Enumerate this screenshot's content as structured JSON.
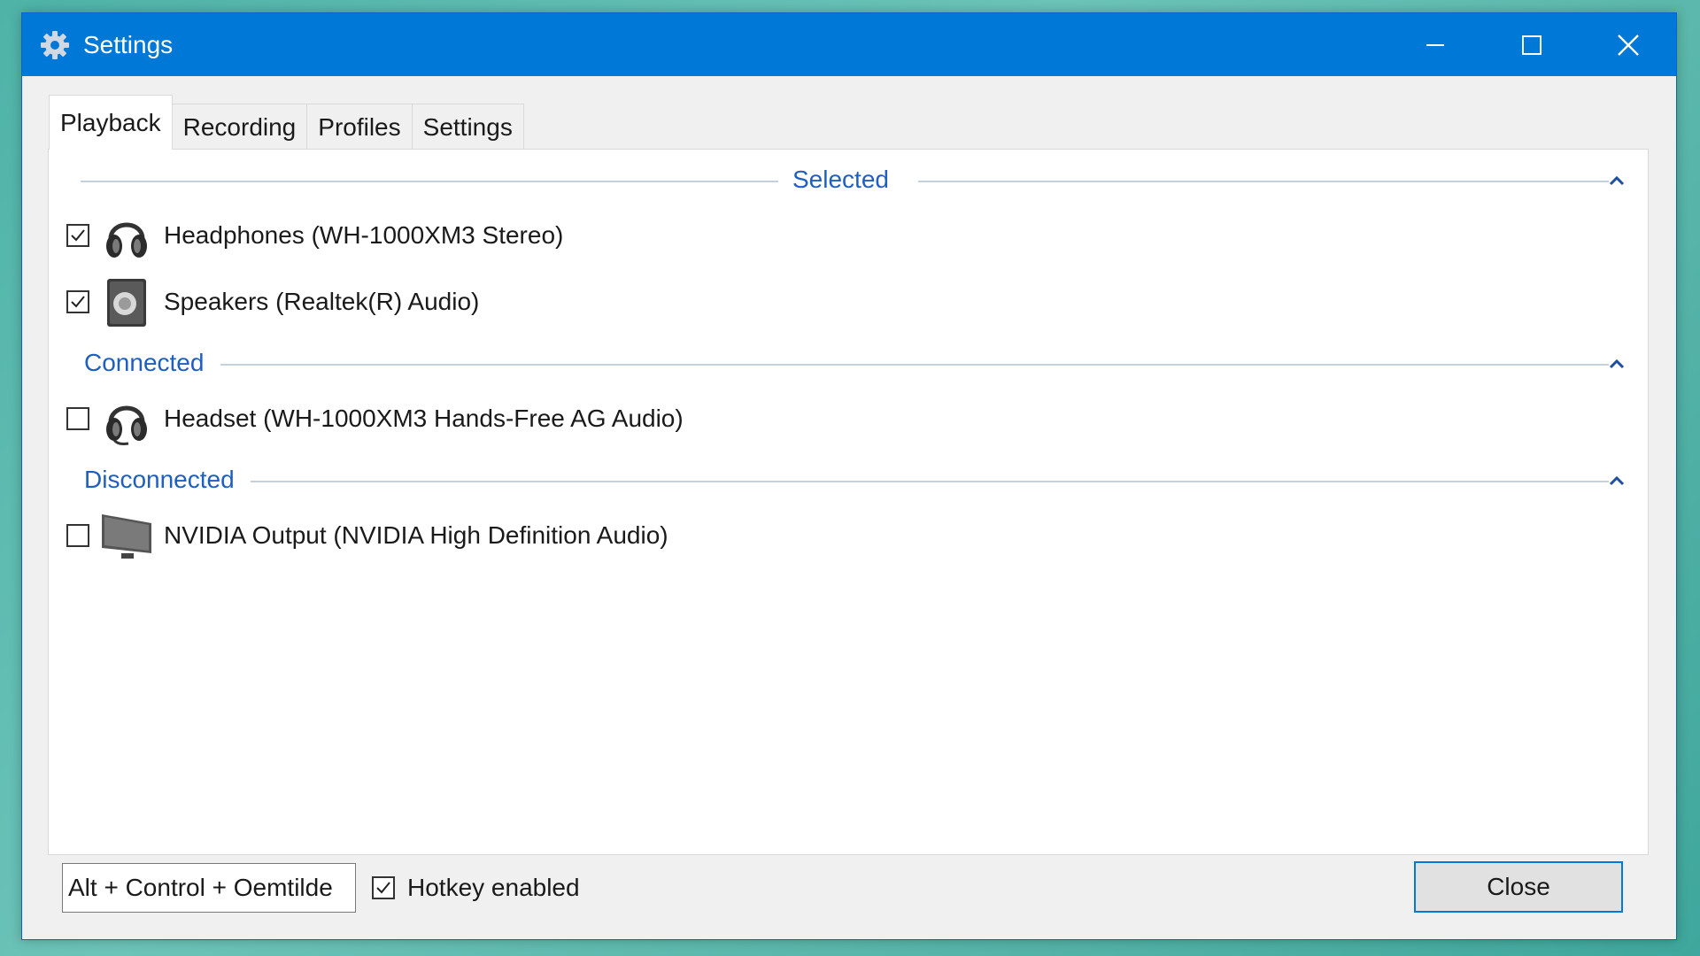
{
  "window": {
    "title": "Settings",
    "accent_color": "#0078d7",
    "icon": "gear-icon"
  },
  "tabs": [
    {
      "label": "Playback",
      "active": true
    },
    {
      "label": "Recording",
      "active": false
    },
    {
      "label": "Profiles",
      "active": false
    },
    {
      "label": "Settings",
      "active": false
    }
  ],
  "groups": {
    "selected": {
      "title": "Selected",
      "devices": [
        {
          "name": "Headphones (WH-1000XM3 Stereo)",
          "checked": true,
          "icon": "headphones-icon"
        },
        {
          "name": "Speakers (Realtek(R) Audio)",
          "checked": true,
          "icon": "speaker-icon"
        }
      ]
    },
    "connected": {
      "title": "Connected",
      "devices": [
        {
          "name": "Headset (WH-1000XM3 Hands-Free AG Audio)",
          "checked": false,
          "icon": "headset-icon"
        }
      ]
    },
    "disconnected": {
      "title": "Disconnected",
      "devices": [
        {
          "name": "NVIDIA Output (NVIDIA High Definition Audio)",
          "checked": false,
          "icon": "monitor-icon"
        }
      ]
    }
  },
  "footer": {
    "hotkey": "Alt + Control + Oemtilde",
    "hotkey_enabled_label": "Hotkey enabled",
    "hotkey_enabled": true,
    "close_label": "Close"
  }
}
